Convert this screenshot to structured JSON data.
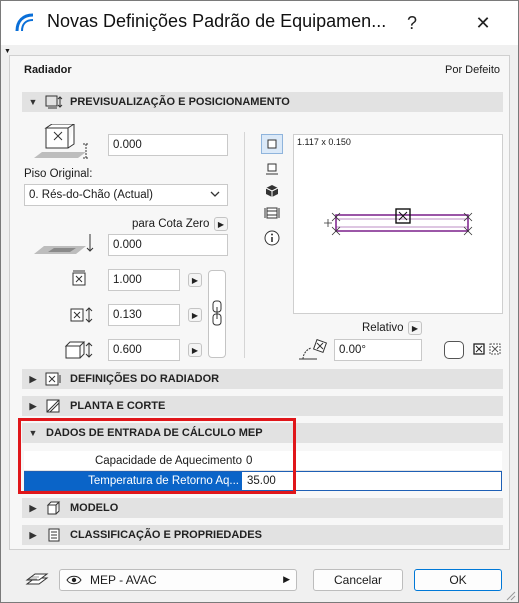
{
  "window": {
    "title": "Novas Definições Padrão de Equipamen...",
    "help_glyph": "?",
    "close_glyph": "✕"
  },
  "header": {
    "object_type": "Radiador",
    "default_label": "Por Defeito"
  },
  "preview_section": {
    "title": "PREVISUALIZAÇÃO E POSICIONAMENTO",
    "elevation_value": "0.000",
    "home_story_label": "Piso Original:",
    "home_story_value": "0. Rés-do-Chão (Actual)",
    "cota_zero_label": "para Cota Zero",
    "cota_zero_value": "0.000",
    "width_value": "1.000",
    "depth_value": "0.130",
    "height_value": "0.600",
    "preview_dims": "1.117 x 0.150",
    "relativo_label": "Relativo",
    "angle_value": "0.00°"
  },
  "sections": {
    "radiator_settings": "DEFINIÇÕES DO RADIADOR",
    "plan_section": "PLANTA E CORTE",
    "mep_input": "DADOS DE ENTRADA DE CÁLCULO MEP",
    "model": "MODELO",
    "classification": "CLASSIFICAÇÃO E PROPRIEDADES"
  },
  "mep_table": {
    "rows": [
      {
        "name": "Capacidade de Aquecimento",
        "value": "0"
      },
      {
        "name": "Temperatura de Retorno Aq...",
        "value": "35.00"
      }
    ]
  },
  "footer": {
    "layer_value": "MEP - AVAC",
    "cancel_label": "Cancelar",
    "ok_label": "OK"
  },
  "colors": {
    "accent": "#0078d7",
    "highlight_box": "#e0161a",
    "selected_row": "#0a64c8",
    "preview_stroke": "#7a1f8a"
  }
}
